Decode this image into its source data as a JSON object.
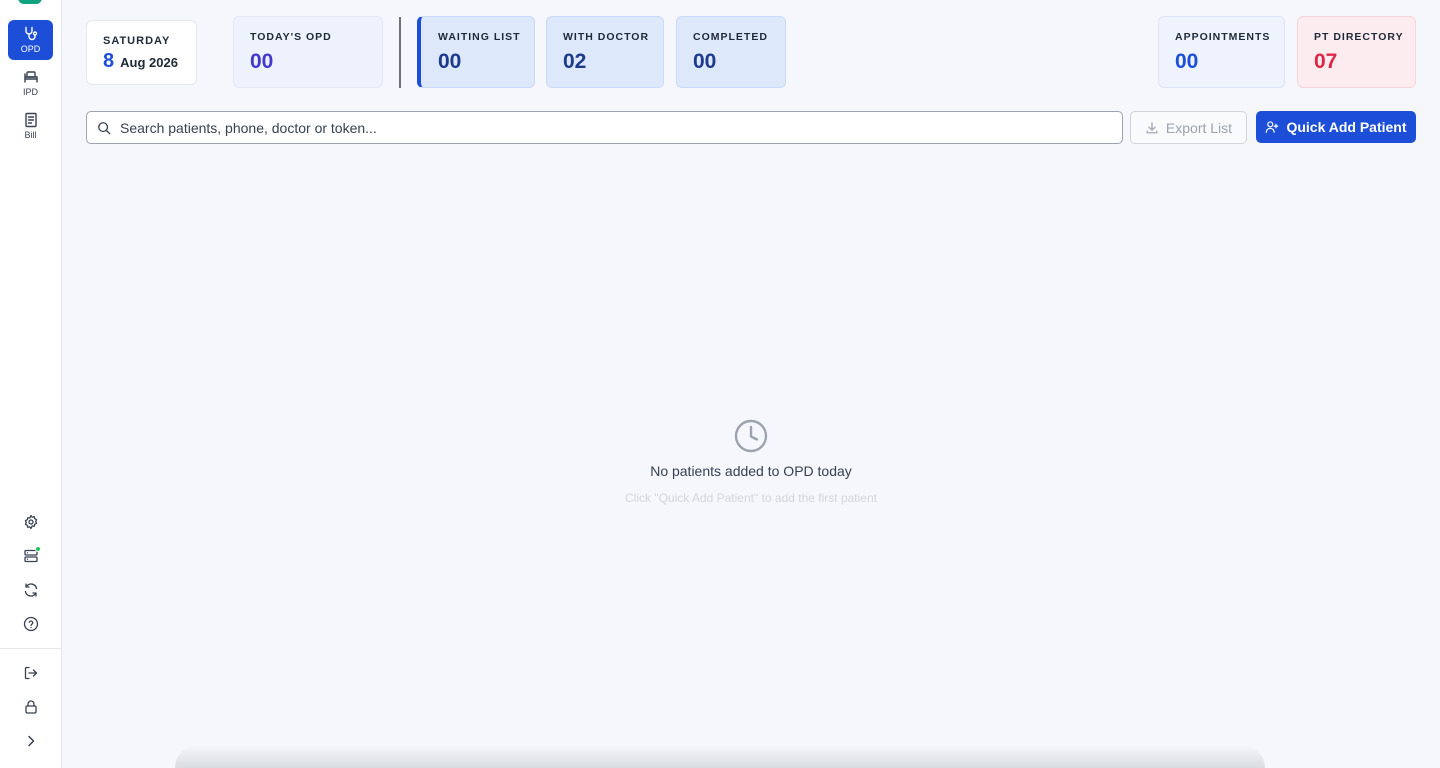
{
  "sidebar": {
    "nav": [
      {
        "label": "OPD",
        "icon": "stethoscope-icon",
        "active": true
      },
      {
        "label": "IPD",
        "icon": "bed-icon",
        "active": false
      },
      {
        "label": "Bill",
        "icon": "bill-icon",
        "active": false
      }
    ],
    "tools": [
      "gear-icon",
      "server-icon",
      "refresh-icon",
      "help-icon"
    ],
    "bottom": [
      "logout-icon",
      "lock-icon",
      "chevron-right-icon"
    ]
  },
  "date": {
    "day": "SATURDAY",
    "number": "8",
    "month_year": "Aug 2026"
  },
  "stats": {
    "todays_opd": {
      "label": "TODAY'S OPD",
      "value": "00"
    },
    "waiting_list": {
      "label": "WAITING LIST",
      "value": "00"
    },
    "with_doctor": {
      "label": "WITH DOCTOR",
      "value": "02"
    },
    "completed": {
      "label": "COMPLETED",
      "value": "00"
    },
    "appointments": {
      "label": "APPOINTMENTS",
      "value": "00"
    },
    "pt_directory": {
      "label": "PT DIRECTORY",
      "value": "07"
    }
  },
  "search": {
    "placeholder": "Search patients, phone, doctor or token...",
    "value": ""
  },
  "actions": {
    "export_label": "Export List",
    "quick_add_label": "Quick Add Patient"
  },
  "empty_state": {
    "icon": "clock-icon",
    "title": "No patients added to OPD today",
    "subtitle": "Click \"Quick Add Patient\" to add the first patient"
  },
  "colors": {
    "primary": "#1d4ed8",
    "danger": "#dc2646",
    "status_online": "#22c55e",
    "brand": "#10a37f"
  }
}
